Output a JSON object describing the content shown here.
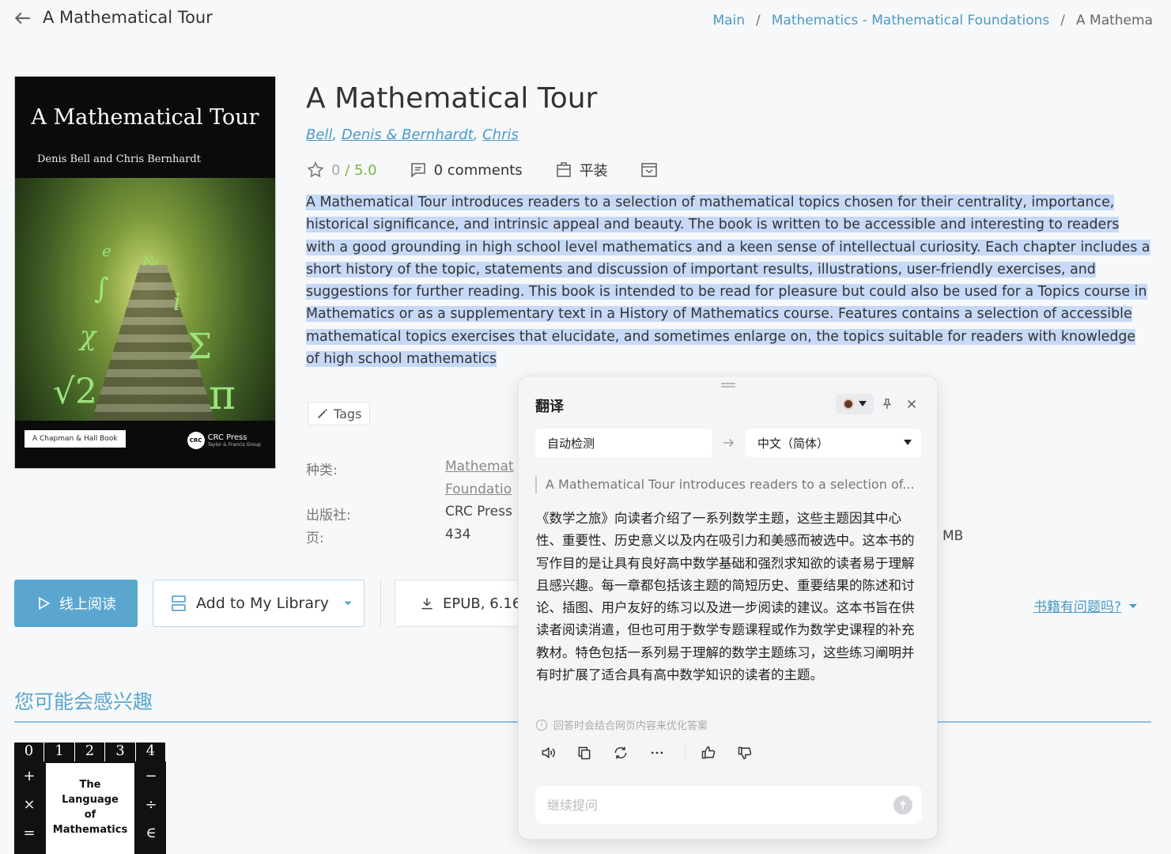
{
  "header": {
    "title": "A Mathematical Tour",
    "breadcrumb": {
      "main": "Main",
      "category": "Mathematics - Mathematical Foundations",
      "current": "A Mathematical Tour"
    }
  },
  "cover": {
    "title": "A Mathematical Tour",
    "authors": "Denis Bell and Chris Bernhardt",
    "series": "A Chapman & Hall Book",
    "publisher_logo": "CRC Press",
    "publisher_logo_sub": "Taylor & Francis Group",
    "logo_mark": "CRC"
  },
  "book": {
    "title": "A Mathematical Tour",
    "authors": [
      {
        "name": "Bell",
        "sep": ", "
      },
      {
        "name": "Denis & Bernhardt",
        "sep": ", "
      },
      {
        "name": "Chris",
        "sep": ""
      }
    ],
    "rating_value": "0",
    "rating_max": "/ 5.0",
    "comments": "0 comments",
    "binding": "平装",
    "description": "A Mathematical Tour introduces readers to a selection of mathematical topics chosen for their centrality, importance, historical significance, and intrinsic appeal and beauty. The book is written to be accessible and interesting to readers with a good grounding in high school level mathematics and a keen sense of intellectual curiosity. Each chapter includes a short history of the topic, statements and discussion of important results, illustrations, user-friendly exercises, and suggestions for further reading. This book is intended to be read for pleasure but could also be used for a Topics course in Mathematics or as a supplementary text in a History of Mathematics course. Features contains a selection of accessible mathematical topics exercises that elucidate, and sometimes enlarge on, the topics suitable for readers with knowledge of high school mathematics",
    "tags_label": "Tags"
  },
  "properties": {
    "category_label": "种类:",
    "category_value_line1": "Mathemat",
    "category_value_line2": "Foundatio",
    "publisher_label": "出版社:",
    "publisher_value": "CRC Press",
    "pages_label": "页:",
    "pages_value": "434",
    "size_tail": "MB"
  },
  "actions": {
    "read_online": "线上阅读",
    "add_library": "Add to My Library",
    "download": "EPUB, 6.16",
    "problem": "书籍有问题吗?"
  },
  "recommend": {
    "title": "您可能会感兴趣",
    "book_title_lines": [
      "The",
      "Language",
      "of",
      "Mathematics"
    ],
    "top_row": [
      "0",
      "1",
      "2",
      "3",
      "4"
    ],
    "left_col": [
      "+",
      "×",
      "="
    ],
    "right_col": [
      "−",
      "÷",
      "∈"
    ]
  },
  "translate": {
    "title": "翻译",
    "source_lang": "自动检测",
    "target_lang": "中文（简体）",
    "source_preview": "A Mathematical Tour introduces readers to a selection of...",
    "result": "《数学之旅》向读者介绍了一系列数学主题，这些主题因其中心性、重要性、历史意义以及内在吸引力和美感而被选中。这本书的写作目的是让具有良好高中数学基础和强烈求知欲的读者易于理解且感兴趣。每一章都包括该主题的简短历史、重要结果的陈述和讨论、插图、用户友好的练习以及进一步阅读的建议。这本书旨在供读者阅读消遣，但也可用于数学专题课程或作为数学史课程的补充教材。特色包括一系列易于理解的数学主题练习，这些练习阐明并有时扩展了适合具有高中数学知识的读者的主题。",
    "note": "回答时会结合网页内容来优化答案",
    "ask_placeholder": "继续提问"
  },
  "colors": {
    "accent": "#5aa6cf",
    "link": "#4a9ac7",
    "selection": "#c6d9f7",
    "rating": "#7ab54b"
  }
}
